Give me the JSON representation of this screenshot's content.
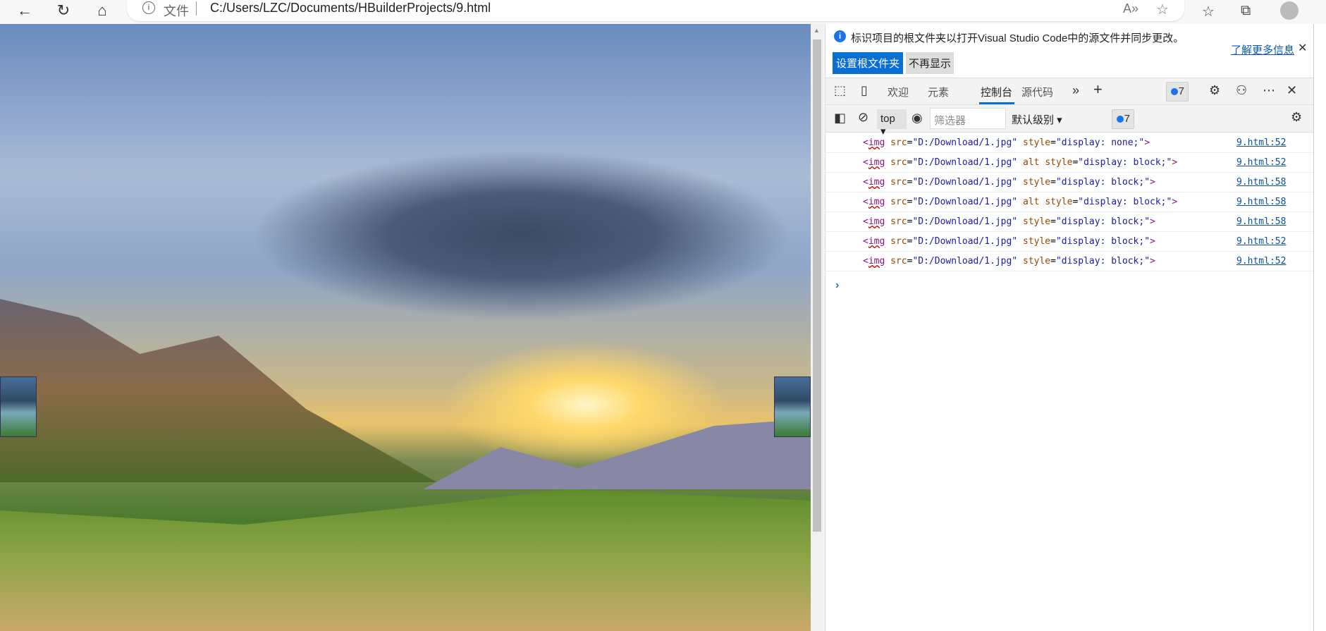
{
  "browser": {
    "url_prefix": "文件",
    "url": "C:/Users/LZC/Documents/HBuilderProjects/9.html"
  },
  "infobar": {
    "message": "标识项目的根文件夹以打开Visual Studio Code中的源文件并同步更改。",
    "primary_button": "设置根文件夹",
    "secondary_button": "不再显示",
    "learn_more": "了解更多信息"
  },
  "tabs": [
    {
      "label": "欢迎"
    },
    {
      "label": "元素"
    },
    {
      "label": "控制台",
      "active": true
    },
    {
      "label": "源代码"
    }
  ],
  "issues_count": "7",
  "console": {
    "context": "top",
    "filter_placeholder": "筛选器",
    "level": "默认级别",
    "issues_count": "7",
    "rows": [
      {
        "src": "\"D:/Download/1.jpg\"",
        "alt": false,
        "style": "\"display: none;\"",
        "source": "9.html:52"
      },
      {
        "src": "\"D:/Download/1.jpg\"",
        "alt": true,
        "style": "\"display: block;\"",
        "source": "9.html:52"
      },
      {
        "src": "\"D:/Download/1.jpg\"",
        "alt": false,
        "style": "\"display: block;\"",
        "source": "9.html:58"
      },
      {
        "src": "\"D:/Download/1.jpg\"",
        "alt": true,
        "style": "\"display: block;\"",
        "source": "9.html:58"
      },
      {
        "src": "\"D:/Download/1.jpg\"",
        "alt": false,
        "style": "\"display: block;\"",
        "source": "9.html:58"
      },
      {
        "src": "\"D:/Download/1.jpg\"",
        "alt": false,
        "style": "\"display: block;\"",
        "source": "9.html:52"
      },
      {
        "src": "\"D:/Download/1.jpg\"",
        "alt": false,
        "style": "\"display: block;\"",
        "source": "9.html:52"
      }
    ]
  }
}
